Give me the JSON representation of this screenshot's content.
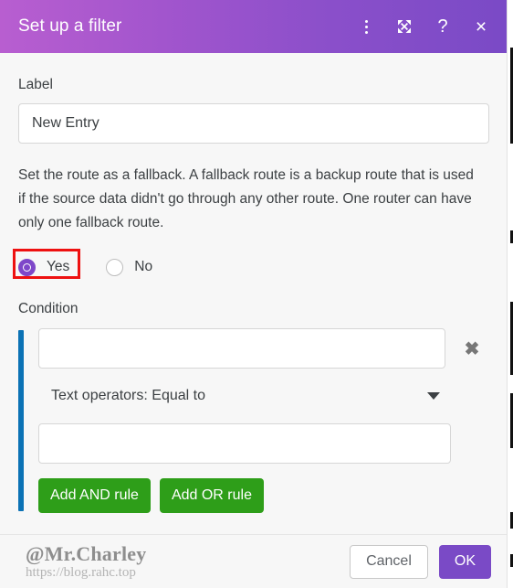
{
  "titlebar": {
    "title": "Set up a filter",
    "icons": [
      {
        "name": "more-options-icon",
        "glyph": "dots"
      },
      {
        "name": "expand-icon",
        "glyph": "expand"
      },
      {
        "name": "help-icon",
        "glyph": "?"
      },
      {
        "name": "close-icon",
        "glyph": "×"
      }
    ]
  },
  "form": {
    "label_caption": "Label",
    "label_value": "New Entry",
    "label_placeholder": "",
    "description": "Set the route as a fallback. A fallback route is a backup route that is used if the source data didn't go through any other route. One router can have only one fallback route.",
    "radio": {
      "yes_label": "Yes",
      "no_label": "No",
      "selected": "Yes"
    },
    "condition_caption": "Condition",
    "condition": {
      "field_value": "",
      "field_placeholder": "",
      "operator_value": "Text operators: Equal to",
      "value_value": "",
      "value_placeholder": "",
      "delete_glyph": "✖",
      "add_and_label": "Add AND rule",
      "add_or_label": "Add OR rule"
    }
  },
  "footer": {
    "watermark_handle": "@Mr.Charley",
    "watermark_url": "https://blog.rahc.top",
    "cancel_label": "Cancel",
    "ok_label": "OK"
  },
  "colors": {
    "header_gradient_start": "#b85ed0",
    "header_gradient_end": "#7a4ac6",
    "accent_purple": "#7e47c9",
    "green_button": "#2e9e19",
    "condition_bar_blue": "#0b72b5",
    "highlight_red": "#ee1111",
    "body_background": "#f7f7f7"
  }
}
